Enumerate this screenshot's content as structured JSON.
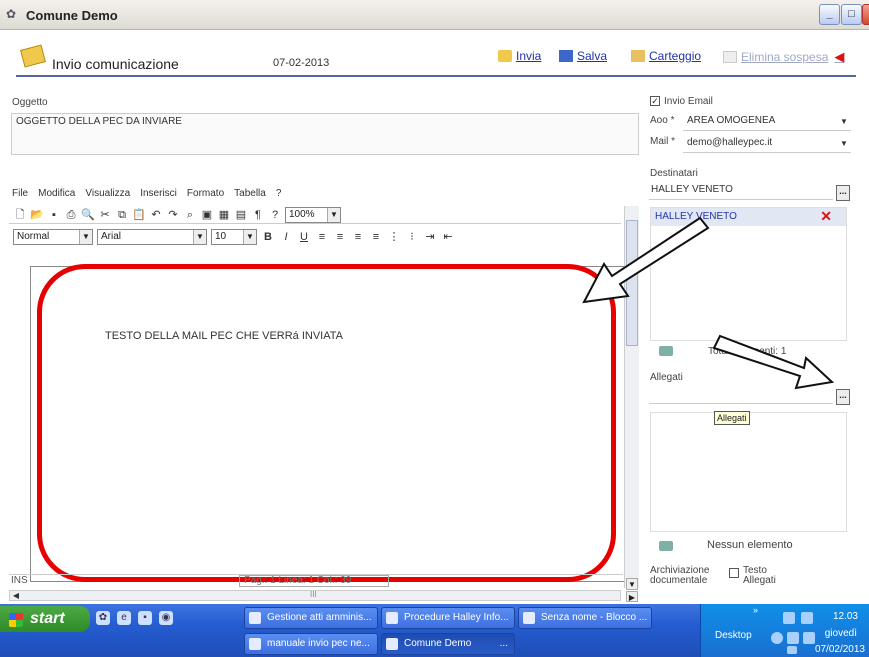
{
  "window": {
    "title": "Comune Demo"
  },
  "header": {
    "title": "Invio comunicazione",
    "date": "07-02-2013",
    "actions": {
      "invia": "Invia",
      "salva": "Salva",
      "carteggio": "Carteggio",
      "elimina": "Elimina sospesa"
    }
  },
  "oggetto": {
    "label": "Oggetto",
    "value": "OGGETTO DELLA PEC DA INVIARE"
  },
  "editor": {
    "menu": [
      "File",
      "Modifica",
      "Visualizza",
      "Inserisci",
      "Formato",
      "Tabella",
      "?"
    ],
    "zoom": "100%",
    "style": "Normal",
    "font": "Arial",
    "size": "10",
    "body_text": "TESTO DELLA MAIL PEC CHE VERRá INVIATA",
    "status_mode": "INS",
    "status_page": "Pag.: 1     Linea: 1     Col.: 39",
    "hscroll_thumb": "III"
  },
  "right": {
    "invio_email": "Invio Email",
    "aoo_label": "Aoo *",
    "aoo_value": "AREA OMOGENEA",
    "mail_label": "Mail *",
    "mail_value": "demo@halleypec.it",
    "destinatari_label": "Destinatari",
    "destinatari_input": "HALLEY VENETO",
    "destinatari_item": "HALLEY VENETO",
    "destinatari_count": "Totale elementi: 1",
    "allegati_label": "Allegati",
    "allegati_tooltip": "Allegati",
    "allegati_empty": "Nessun elemento",
    "archiviazione": "Archiviazione documentale",
    "testo_allegati": "Testo Allegati",
    "ellipsis": "..."
  },
  "taskbar": {
    "start": "start",
    "tasks": [
      "Gestione atti amminis...",
      "Procedure Halley Info...",
      "Senza nome - Blocco ...",
      "manuale invio pec ne...",
      "Comune Demo"
    ],
    "more": "...",
    "desktop": "Desktop",
    "chevron": "»",
    "time": "12.03",
    "day": "giovedì",
    "date": "07/02/2013"
  }
}
